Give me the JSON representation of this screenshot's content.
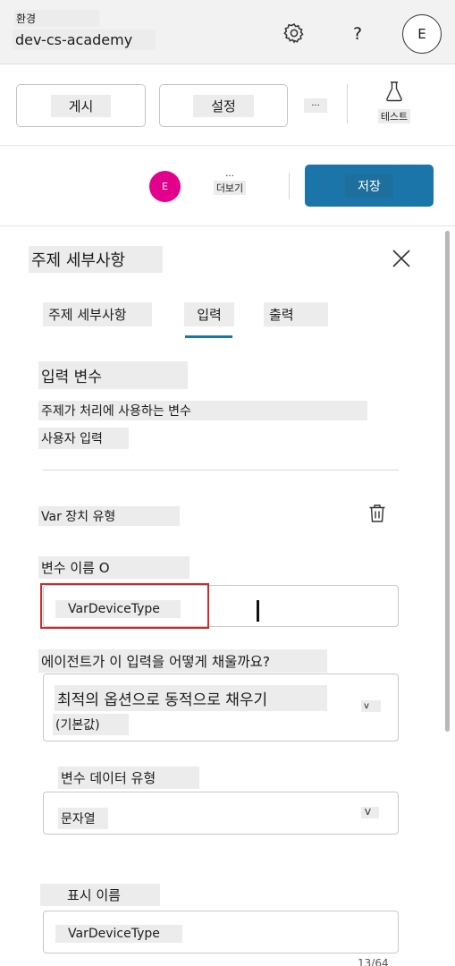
{
  "header": {
    "env_label": "환경",
    "env_name": "dev-cs-academy",
    "help_label": "?",
    "user_initial": "E"
  },
  "toolbar": {
    "publish_label": "게시",
    "settings_label": "설정",
    "more_label": "...",
    "test_label": "테스트"
  },
  "action_bar": {
    "avatar_initial": "E",
    "more_dots": "...",
    "more_label": "더보기",
    "save_label": "저장"
  },
  "panel": {
    "title": "주제 세부사항",
    "tabs": [
      {
        "label": "주제 세부사항",
        "selected": false
      },
      {
        "label": "입력",
        "selected": true
      },
      {
        "label": "출력",
        "selected": false
      }
    ],
    "section_title": "입력 변수",
    "section_desc": "주제가 처리에 사용하는 변수",
    "user_input_label": "사용자 입력",
    "variable": {
      "title": "Var 장치 유형",
      "name_label": "변수 이름 O",
      "name_value": "VarDeviceType",
      "fill_question": "에이전트가 이 입력을 어떻게 채울까요?",
      "fill_value_line1": "최적의 옵션으로 동적으로 채우기",
      "fill_value_line2": "(기본값)",
      "fill_chevron": "v",
      "data_type_label": "변수 데이터 유형",
      "data_type_value": "문자열",
      "data_type_chevron": "V",
      "display_name_label": "표시 이름",
      "display_name_value": "VarDeviceType",
      "char_counter": "13/64"
    }
  },
  "colors": {
    "accent": "#1b75a8",
    "avatar_pink": "#e3008c",
    "highlight_red": "#d4262b"
  }
}
